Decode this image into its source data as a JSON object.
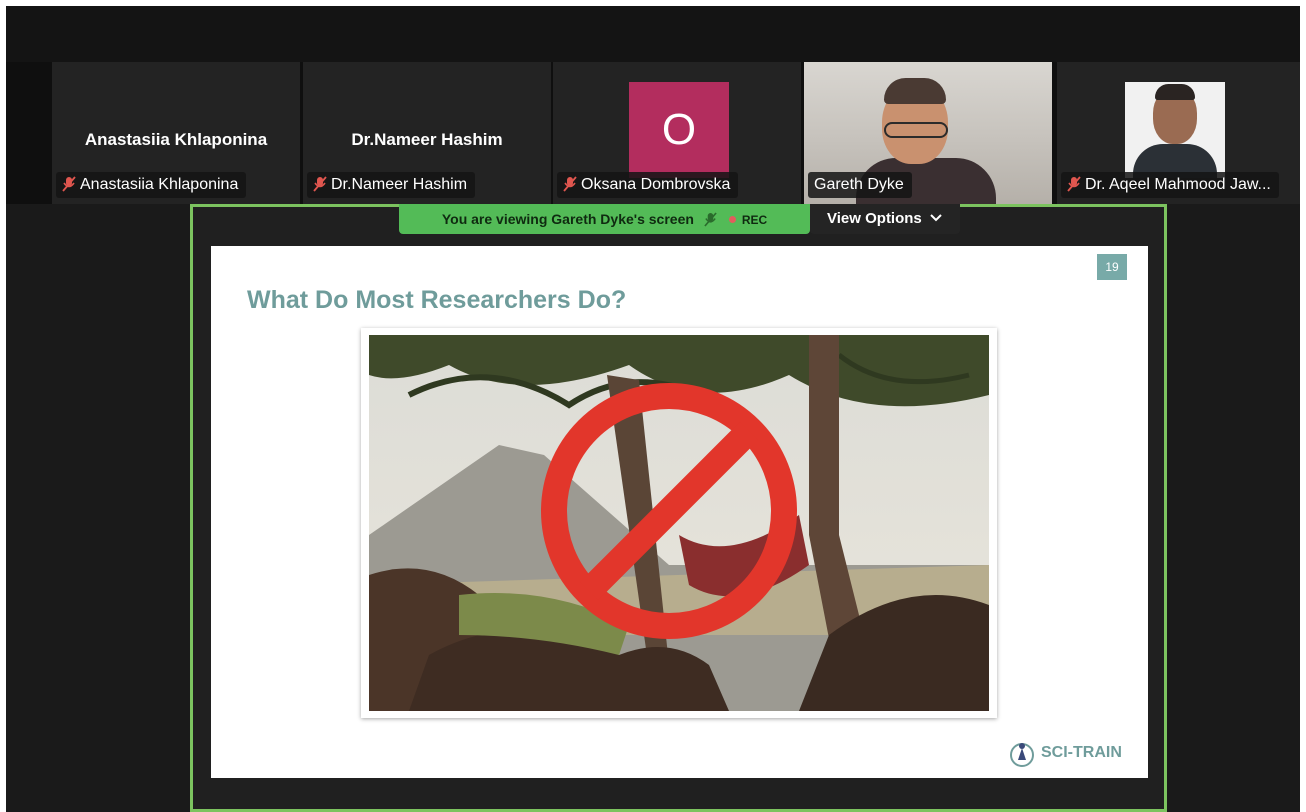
{
  "participants": [
    {
      "display_name": "Anastasiia Khlaponina",
      "tag": "Anastasiia Khlaponina",
      "muted": true
    },
    {
      "display_name": "Dr.Nameer Hashim",
      "tag": "Dr.Nameer Hashim",
      "muted": true
    },
    {
      "avatar_letter": "O",
      "tag": "Oksana Dombrovska",
      "muted": true
    },
    {
      "tag": "Gareth Dyke",
      "muted": false,
      "active": true
    },
    {
      "tag": "Dr. Aqeel Mahmood Jaw...",
      "muted": true
    }
  ],
  "share_banner": {
    "text": "You are viewing  Gareth Dyke's screen",
    "rec_label": "REC"
  },
  "view_options": {
    "label": "View Options"
  },
  "slide": {
    "title": "What Do Most Researchers Do?",
    "page_number": "19",
    "logo_text": "SCI-TRAIN"
  },
  "colors": {
    "share_border": "#7cc35f",
    "banner_bg": "#53bb57",
    "slide_accent": "#6f9c9b",
    "avatar_bg": "#b32d5e",
    "mute_icon": "#e0564f",
    "prohibition": "#e2362b"
  },
  "icons": [
    "mic-muted-icon",
    "chevron-down-icon",
    "prohibition-icon",
    "sci-train-logo-icon"
  ]
}
